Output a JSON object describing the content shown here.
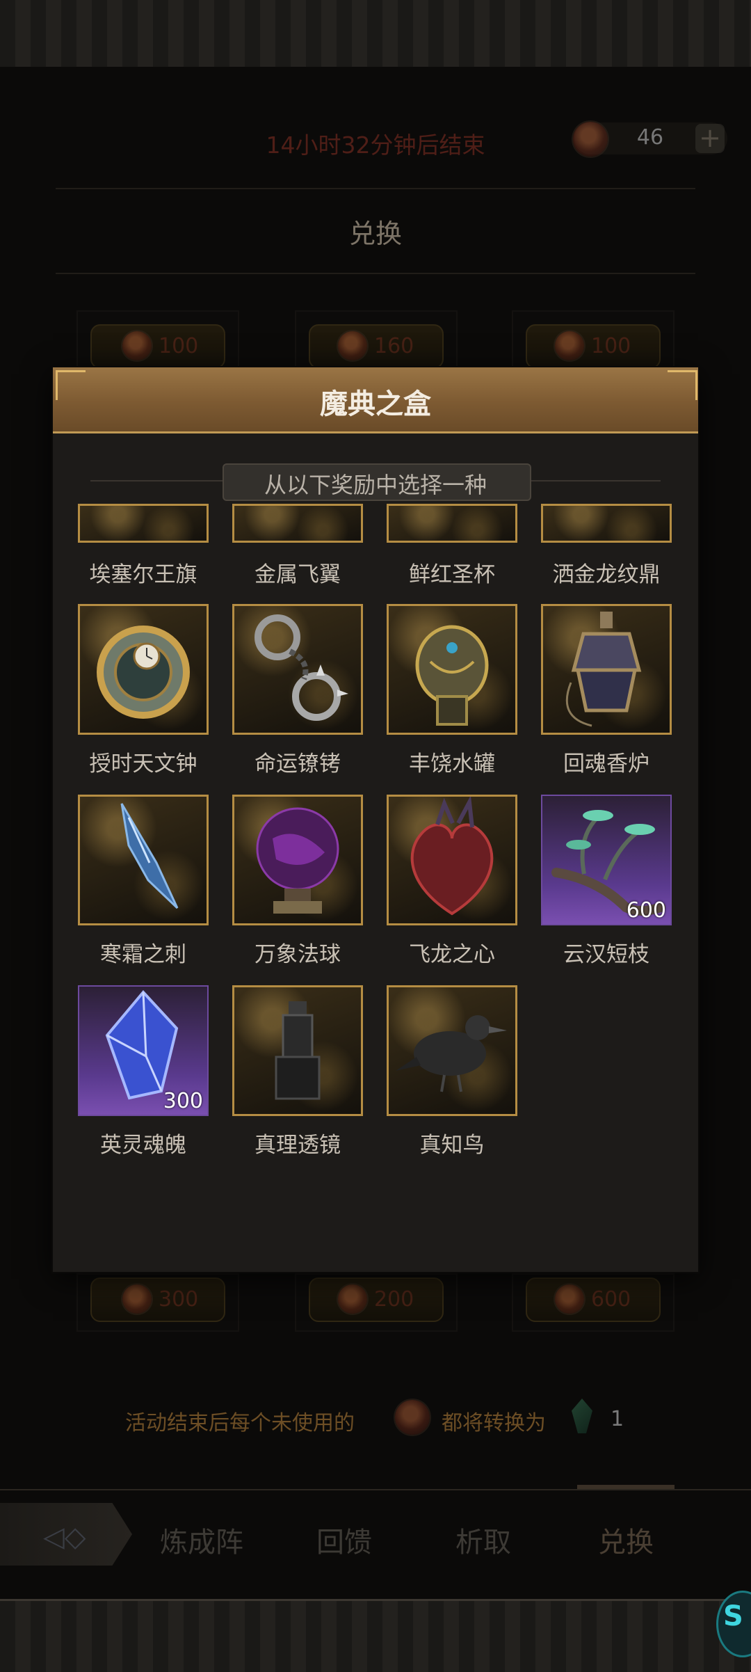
{
  "status": {
    "timer_text": "14小时32分钟后结束",
    "currency_count": "46",
    "add_label": "+"
  },
  "exchange": {
    "title": "兑换",
    "row1_prices": [
      "100",
      "160",
      "100"
    ],
    "row2_prices": [
      "300",
      "200",
      "600"
    ]
  },
  "footer": {
    "note_part1": "活动结束后每个未使用的",
    "note_part2": "都将转换为",
    "gem_count": "1"
  },
  "nav": {
    "tabs": [
      "炼成阵",
      "回馈",
      "析取",
      "兑换"
    ],
    "active": "兑换"
  },
  "assistant": {
    "label": "S"
  },
  "modal": {
    "title": "魔典之盒",
    "subtitle": "从以下奖励中选择一种",
    "rewards": [
      {
        "name": "埃塞尔王旗",
        "rarity": "gold"
      },
      {
        "name": "金属飞翼",
        "rarity": "gold"
      },
      {
        "name": "鲜红圣杯",
        "rarity": "gold"
      },
      {
        "name": "洒金龙纹鼎",
        "rarity": "gold"
      },
      {
        "name": "授时天文钟",
        "rarity": "gold",
        "icon": "astronomical-clock-icon"
      },
      {
        "name": "命运镣铐",
        "rarity": "gold",
        "icon": "shackles-icon"
      },
      {
        "name": "丰饶水罐",
        "rarity": "gold",
        "icon": "water-jar-icon"
      },
      {
        "name": "回魂香炉",
        "rarity": "gold",
        "icon": "censer-icon"
      },
      {
        "name": "寒霜之刺",
        "rarity": "gold",
        "icon": "frost-thorn-icon"
      },
      {
        "name": "万象法球",
        "rarity": "gold",
        "icon": "magic-orb-icon"
      },
      {
        "name": "飞龙之心",
        "rarity": "gold",
        "icon": "dragon-heart-icon"
      },
      {
        "name": "云汉短枝",
        "rarity": "purple",
        "qty": "600",
        "icon": "branch-icon"
      },
      {
        "name": "英灵魂魄",
        "rarity": "purple",
        "qty": "300",
        "icon": "soul-crystal-icon"
      },
      {
        "name": "真理透镜",
        "rarity": "gold",
        "icon": "truth-lens-icon"
      },
      {
        "name": "真知鸟",
        "rarity": "gold",
        "icon": "raven-icon"
      }
    ]
  },
  "colors": {
    "modal_header": "#8a6539",
    "gold_border": "#b58d43",
    "purple_tile": "#5a3a8e",
    "timer_red": "#a3372a"
  }
}
